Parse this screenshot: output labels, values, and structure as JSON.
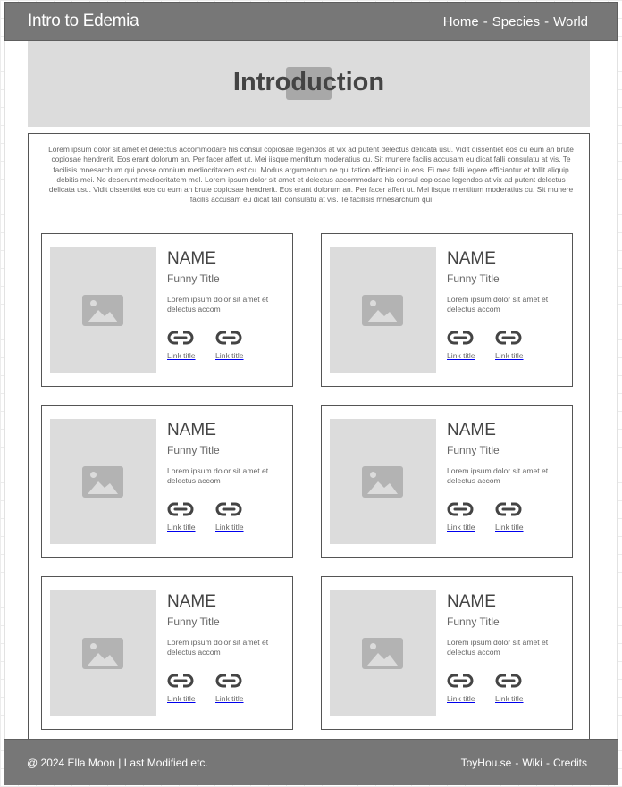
{
  "header": {
    "site_title": "Intro to Edemia",
    "nav": [
      {
        "label": "Home"
      },
      {
        "label": "Species"
      },
      {
        "label": "World"
      }
    ],
    "separator": "-"
  },
  "hero": {
    "title": "Introduction",
    "image_icon": "image-placeholder-icon"
  },
  "intro": {
    "text": "Lorem ipsum dolor sit amet et delectus accommodare his consul copiosae legendos at vix ad putent delectus delicata usu. Vidit dissentiet eos cu eum an brute copiosae hendrerit. Eos erant dolorum an. Per facer affert ut. Mei iisque mentitum moderatius cu. Sit munere facilis accusam eu dicat falli consulatu at vis. Te facilisis mnesarchum qui posse omnium mediocritatem est cu. Modus argumentum ne qui tation efficiendi in eos. Ei mea falli legere efficiantur et tollit aliquip debitis mei. No deserunt mediocritatem mel. Lorem ipsum dolor sit amet et delectus accommodare his consul copiosae legendos at vix ad putent delectus delicata usu. Vidit dissentiet eos cu eum an brute copiosae hendrerit. Eos erant dolorum an. Per facer affert ut. Mei iisque mentitum moderatius cu. Sit munere facilis accusam eu dicat falli consulatu at vis. Te facilisis mnesarchum qui"
  },
  "cards": [
    {
      "name": "NAME",
      "title": "Funny Title",
      "description": "Lorem ipsum dolor sit amet et delectus accom",
      "links": [
        {
          "label": "Link title",
          "icon": "link-icon"
        },
        {
          "label": "Link title",
          "icon": "link-icon"
        }
      ]
    },
    {
      "name": "NAME",
      "title": "Funny Title",
      "description": "Lorem ipsum dolor sit amet et delectus accom",
      "links": [
        {
          "label": "Link title",
          "icon": "link-icon"
        },
        {
          "label": "Link title",
          "icon": "link-icon"
        }
      ]
    },
    {
      "name": "NAME",
      "title": "Funny Title",
      "description": "Lorem ipsum dolor sit amet et delectus accom",
      "links": [
        {
          "label": "Link title",
          "icon": "link-icon"
        },
        {
          "label": "Link title",
          "icon": "link-icon"
        }
      ]
    },
    {
      "name": "NAME",
      "title": "Funny Title",
      "description": "Lorem ipsum dolor sit amet et delectus accom",
      "links": [
        {
          "label": "Link title",
          "icon": "link-icon"
        },
        {
          "label": "Link title",
          "icon": "link-icon"
        }
      ]
    },
    {
      "name": "NAME",
      "title": "Funny Title",
      "description": "Lorem ipsum dolor sit amet et delectus accom",
      "links": [
        {
          "label": "Link title",
          "icon": "link-icon"
        },
        {
          "label": "Link title",
          "icon": "link-icon"
        }
      ]
    },
    {
      "name": "NAME",
      "title": "Funny Title",
      "description": "Lorem ipsum dolor sit amet et delectus accom",
      "links": [
        {
          "label": "Link title",
          "icon": "link-icon"
        },
        {
          "label": "Link title",
          "icon": "link-icon"
        }
      ]
    }
  ],
  "footer": {
    "credit": "@ 2024 Ella Moon | Last Modified etc.",
    "links": [
      {
        "label": "ToyHou.se"
      },
      {
        "label": "Wiki"
      },
      {
        "label": "Credits"
      }
    ],
    "separator": "-"
  },
  "colors": {
    "bar": "#777777",
    "placeholder": "#dcdcdc",
    "placeholder_icon": "#b3b3b3",
    "text": "#444444"
  }
}
